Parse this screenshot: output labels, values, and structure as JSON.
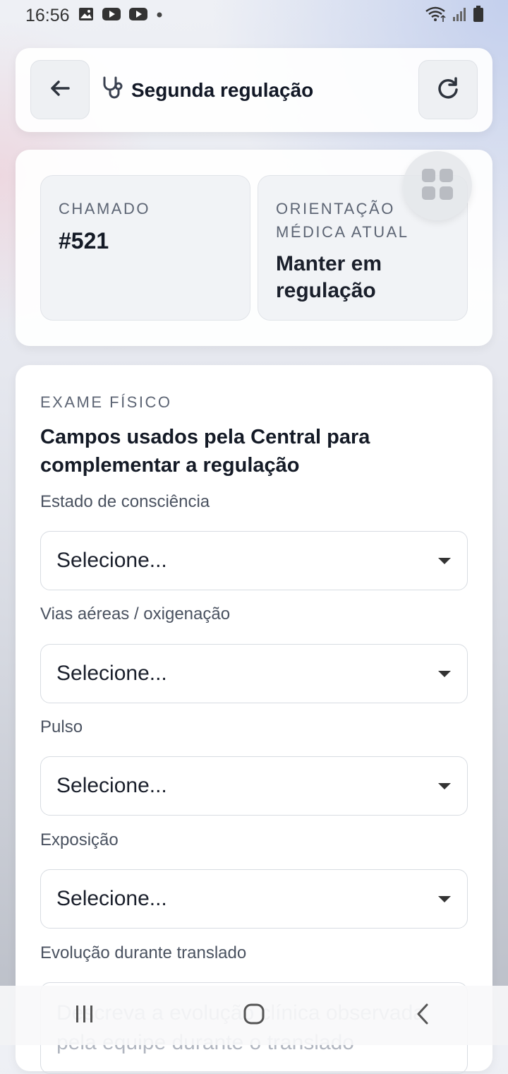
{
  "status_bar": {
    "time": "16:56",
    "left_icons": [
      "image-icon",
      "youtube-icon",
      "youtube-icon",
      "dot-icon"
    ],
    "right_icons": [
      "wifi-icon",
      "signal-icon",
      "battery-icon"
    ]
  },
  "header": {
    "title": "Segunda regulação",
    "back_icon": "arrow-left-icon",
    "title_icon": "stethoscope-icon",
    "refresh_icon": "refresh-icon"
  },
  "info": {
    "chamado_label": "CHAMADO",
    "chamado_value": "#521",
    "orientacao_label": "ORIENTAÇÃO MÉDICA ATUAL",
    "orientacao_value": "Manter em regulação",
    "grid_icon": "grid-icon"
  },
  "form": {
    "section_label": "EXAME FÍSICO",
    "section_title": "Campos usados pela Central para complementar a regulação",
    "fields": [
      {
        "label": "Estado de consciência",
        "value": "Selecione..."
      },
      {
        "label": "Vias aéreas / oxigenação",
        "value": "Selecione..."
      },
      {
        "label": "Pulso",
        "value": "Selecione..."
      },
      {
        "label": "Exposição",
        "value": "Selecione..."
      }
    ],
    "textarea": {
      "label": "Evolução durante translado",
      "placeholder": "Descreva a evolução clínica observada pela equipe durante o translado"
    }
  },
  "nav": {
    "icons": [
      "recent-apps-icon",
      "home-icon",
      "back-icon"
    ]
  },
  "colors": {
    "text_dark": "#141a26",
    "text_muted": "#5d6574",
    "tile_bg": "#f1f3f6"
  }
}
